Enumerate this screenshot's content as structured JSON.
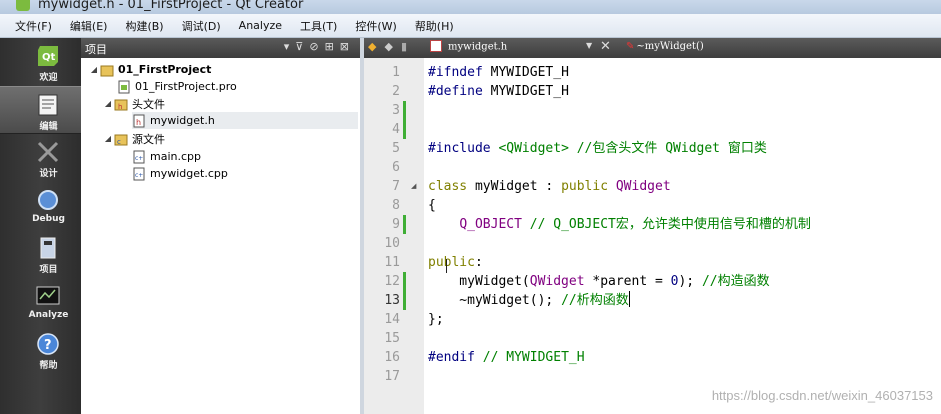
{
  "window": {
    "title": "mywidget.h - 01_FirstProject - Qt Creator"
  },
  "menu": [
    "文件(F)",
    "编辑(E)",
    "构建(B)",
    "调试(D)",
    "Analyze",
    "工具(T)",
    "控件(W)",
    "帮助(H)"
  ],
  "modes": [
    {
      "label": "欢迎",
      "icon": "qt-logo-icon"
    },
    {
      "label": "编辑",
      "icon": "edit-document-icon"
    },
    {
      "label": "设计",
      "icon": "design-icon"
    },
    {
      "label": "Debug",
      "icon": "debug-icon"
    },
    {
      "label": "项目",
      "icon": "project-icon"
    },
    {
      "label": "Analyze",
      "icon": "analyze-icon"
    },
    {
      "label": "帮助",
      "icon": "help-icon"
    }
  ],
  "project_panel": {
    "title": "项目",
    "tree": {
      "project": "01_FirstProject",
      "pro_file": "01_FirstProject.pro",
      "headers_folder": "头文件",
      "header_file": "mywidget.h",
      "sources_folder": "源文件",
      "source_files": [
        "main.cpp",
        "mywidget.cpp"
      ]
    }
  },
  "editor": {
    "file_tab": "mywidget.h",
    "symbol": "~myWidget()",
    "current_line": 13,
    "lines": [
      "#ifndef MYWIDGET_H",
      "#define MYWIDGET_H",
      "",
      "",
      "#include <QWidget> //包含头文件 QWidget 窗口类",
      "",
      "class myWidget : public QWidget",
      "{",
      "    Q_OBJECT // Q_OBJECT宏，允许类中使用信号和槽的机制",
      "",
      "public:",
      "    myWidget(QWidget *parent = 0); //构造函数",
      "    ~myWidget(); //析构函数",
      "};",
      "",
      "#endif // MYWIDGET_H",
      ""
    ]
  },
  "watermark": "https://blog.csdn.net/weixin_46037153",
  "colors": {
    "keyword": "#808000",
    "preprocessor": "#000080",
    "class": "#800080",
    "comment": "#008000",
    "modified": "#3fae35"
  }
}
